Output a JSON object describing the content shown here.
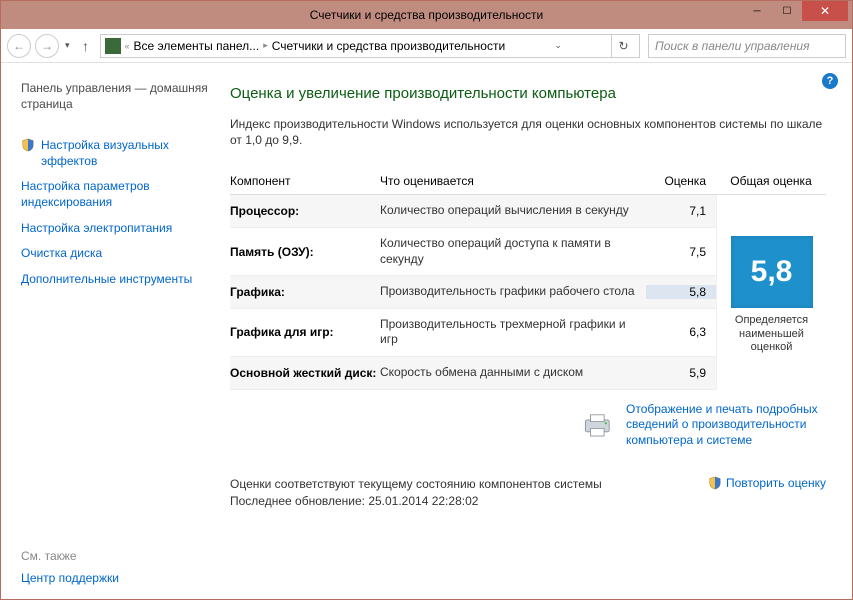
{
  "titlebar": {
    "title": "Счетчики и средства производительности"
  },
  "nav": {
    "breadcrumb_root": "Все элементы панел...",
    "breadcrumb_current": "Счетчики и средства производительности",
    "search_placeholder": "Поиск в панели управления"
  },
  "sidebar": {
    "home": "Панель управления — домашняя страница",
    "items": [
      "Настройка визуальных эффектов",
      "Настройка параметров индексирования",
      "Настройка электропитания",
      "Очистка диска",
      "Дополнительные инструменты"
    ],
    "see_also_label": "См. также",
    "see_also_link": "Центр поддержки"
  },
  "main": {
    "heading": "Оценка и увеличение производительности компьютера",
    "description": "Индекс производительности Windows используется для оценки основных компонентов системы по шкале от 1,0 до 9,9.",
    "th_component": "Компонент",
    "th_what": "Что оценивается",
    "th_score": "Оценка",
    "th_base": "Общая оценка",
    "rows": [
      {
        "comp": "Процессор:",
        "what": "Количество операций вычисления в секунду",
        "score": "7,1"
      },
      {
        "comp": "Память (ОЗУ):",
        "what": "Количество операций доступа к памяти в секунду",
        "score": "7,5"
      },
      {
        "comp": "Графика:",
        "what": "Производительность графики рабочего стола",
        "score": "5,8"
      },
      {
        "comp": "Графика для игр:",
        "what": "Производительность трехмерной графики и игр",
        "score": "6,3"
      },
      {
        "comp": "Основной жесткий диск:",
        "what": "Скорость обмена данными с диском",
        "score": "5,9"
      }
    ],
    "base_score": "5,8",
    "base_caption": "Определяется наименьшей оценкой",
    "print_link": "Отображение и печать подробных сведений о производительности компьютера и системе",
    "status_line1": "Оценки соответствуют текущему состоянию компонентов системы",
    "status_line2": "Последнее обновление: 25.01.2014 22:28:02",
    "rerun": "Повторить оценку"
  }
}
